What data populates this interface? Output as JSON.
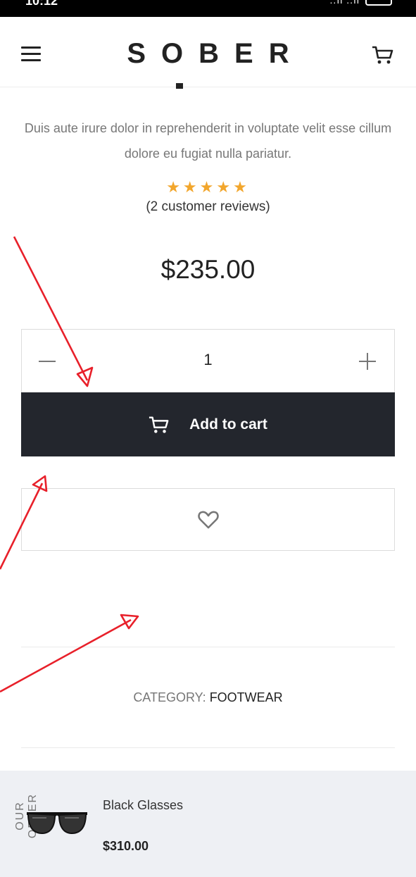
{
  "status_bar": {
    "time": "10:12",
    "signal": "..ıl ..ıl"
  },
  "header": {
    "logo": "SOBER",
    "menu_icon": "hamburger-icon",
    "cart_icon": "cart-icon"
  },
  "product": {
    "description": "Duis aute irure dolor in reprehenderit in voluptate velit esse cillum dolore eu fugiat nulla pariatur.",
    "rating": 5,
    "stars": "★★★★★",
    "reviews": "(2 customer reviews)",
    "price": "$235.00",
    "quantity": "1",
    "add_to_cart_label": "Add to cart",
    "category_label": "CATEGORY:",
    "category_value": "FOOTWEAR"
  },
  "offer": {
    "section_label": "OUR OFFER",
    "item_name": "Black Glasses",
    "item_price": "$310.00"
  },
  "colors": {
    "button_bg": "#23262d",
    "star": "#f2a62c",
    "annotation": "#e8202a",
    "offer_bg": "#eef0f4"
  }
}
